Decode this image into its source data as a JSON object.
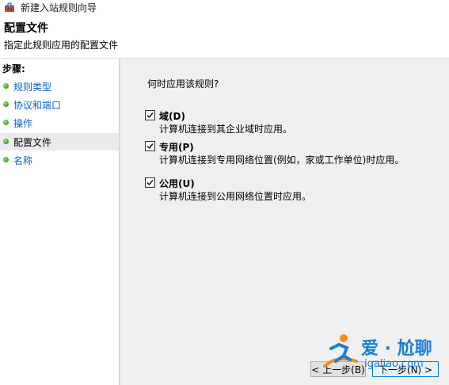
{
  "window": {
    "title": "新建入站规则向导",
    "icon": "firewall-icon"
  },
  "header": {
    "title": "配置文件",
    "subtitle": "指定此规则应用的配置文件"
  },
  "sidebar": {
    "heading": "步骤:",
    "items": [
      {
        "label": "规则类型",
        "active": false
      },
      {
        "label": "协议和端口",
        "active": false
      },
      {
        "label": "操作",
        "active": false
      },
      {
        "label": "配置文件",
        "active": true
      },
      {
        "label": "名称",
        "active": false
      }
    ]
  },
  "main": {
    "question": "何时应用该规则?",
    "options": [
      {
        "label": "域(D)",
        "checked": true,
        "description": "计算机连接到其企业域时应用。"
      },
      {
        "label": "专用(P)",
        "checked": true,
        "description": "计算机连接到专用网络位置(例如，家或工作单位)时应用。"
      },
      {
        "label": "公用(U)",
        "checked": true,
        "description": "计算机连接到公用网络位置时应用。"
      }
    ]
  },
  "buttons": {
    "back": "< 上一步(B)",
    "next": "下一步(N) >"
  },
  "watermark": {
    "text": "爱 · 尬聊",
    "url": "igaliao.com"
  },
  "colors": {
    "link": "#0a5fc7",
    "content_bg": "#f0f0f0",
    "active_step_bg": "#ebebeb"
  }
}
